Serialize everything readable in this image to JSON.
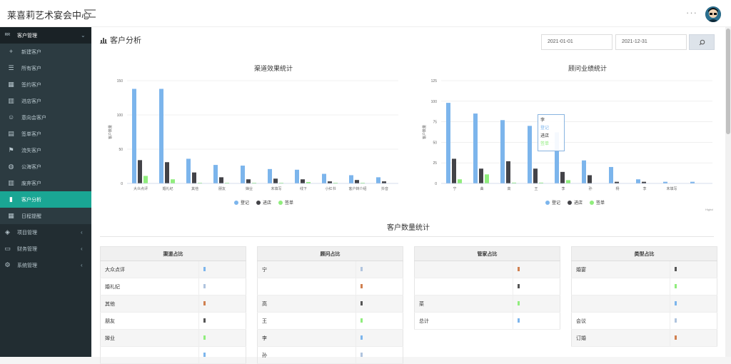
{
  "header": {
    "brand": "莱喜莉艺术宴会中心",
    "more": "···"
  },
  "sidebar": {
    "items": [
      {
        "label": "客户管理",
        "icon": "users-icon",
        "type": "parent",
        "chev": "⌄"
      },
      {
        "label": "新建客户",
        "icon": "plus-icon",
        "type": "child"
      },
      {
        "label": "所有客户",
        "icon": "list-icon",
        "type": "child"
      },
      {
        "label": "签约客户",
        "icon": "calendar-icon",
        "type": "child"
      },
      {
        "label": "进店客户",
        "icon": "bank-icon",
        "type": "child"
      },
      {
        "label": "意向会客户",
        "icon": "smile-icon",
        "type": "child"
      },
      {
        "label": "签单客户",
        "icon": "file-icon",
        "type": "child"
      },
      {
        "label": "流失客户",
        "icon": "flag-icon",
        "type": "child"
      },
      {
        "label": "公海客户",
        "icon": "globe-icon",
        "type": "child"
      },
      {
        "label": "废弃客户",
        "icon": "bank-icon",
        "type": "child"
      },
      {
        "label": "客户分析",
        "icon": "bar-chart-icon",
        "type": "active"
      },
      {
        "label": "日程提醒",
        "icon": "calendar-icon",
        "type": "child"
      },
      {
        "label": "项目管理",
        "icon": "cube-icon",
        "type": "group",
        "chev": "‹"
      },
      {
        "label": "财务管理",
        "icon": "money-icon",
        "type": "group",
        "chev": "‹"
      },
      {
        "label": "系统管理",
        "icon": "gear-icon",
        "type": "group",
        "chev": "‹"
      }
    ]
  },
  "main": {
    "page_title": "客户分析",
    "start_date": "2021-01-01",
    "end_date": "2021-12-31",
    "section_title": "客户数量统计",
    "credit": "Highcl"
  },
  "tooltip": {
    "lines": [
      "李",
      "登记",
      "进店",
      "签单"
    ]
  },
  "colors": {
    "blue": "#7cb5ec",
    "black": "#434348",
    "green": "#90ed7d",
    "teal": "#1aa694"
  },
  "chart_data": [
    {
      "type": "bar",
      "title": "渠道效果统计",
      "ylabel": "客户数量",
      "ylim": [
        0,
        150
      ],
      "yticks": [
        0,
        50,
        100,
        150
      ],
      "categories": [
        "大众点评",
        "婚礼纪",
        "其他",
        "朋友",
        "婵业",
        "未填写",
        "线下",
        "小红书",
        "客户转介绍",
        "抖音"
      ],
      "series": [
        {
          "name": "登记",
          "values": [
            138,
            138,
            36,
            27,
            26,
            21,
            20,
            14,
            12,
            9
          ]
        },
        {
          "name": "进店",
          "values": [
            34,
            31,
            16,
            9,
            6,
            7,
            6,
            3,
            5,
            3
          ]
        },
        {
          "name": "签单",
          "values": [
            11,
            6,
            1,
            1,
            1,
            1,
            2,
            1,
            1,
            0
          ]
        }
      ],
      "legend": "bottom-center"
    },
    {
      "type": "bar",
      "title": "顾问业绩统计",
      "ylabel": "客户数量",
      "ylim": [
        0,
        125
      ],
      "yticks": [
        0,
        25,
        50,
        75,
        100,
        125
      ],
      "categories": [
        "宁",
        "曲",
        "高",
        "王",
        "李",
        "孙",
        "杨",
        "李",
        "未填写",
        ""
      ],
      "series": [
        {
          "name": "登记",
          "values": [
            98,
            85,
            77,
            70,
            62,
            28,
            20,
            5,
            2,
            2
          ]
        },
        {
          "name": "进店",
          "values": [
            30,
            18,
            27,
            18,
            14,
            10,
            2,
            2,
            0,
            0
          ]
        },
        {
          "name": "签单",
          "values": [
            5,
            11,
            1,
            1,
            4,
            0,
            0,
            0,
            0,
            0
          ]
        }
      ],
      "legend": "bottom-center"
    }
  ],
  "tables": [
    {
      "header": "渠道占比",
      "rows": [
        "大众点评",
        "婚礼纪",
        "其他",
        "朋友",
        "婵业",
        ""
      ]
    },
    {
      "header": "顾问占比",
      "rows": [
        "宁",
        "",
        "高",
        "王",
        "李",
        "孙"
      ]
    },
    {
      "header": "管家占比",
      "rows": [
        "",
        "",
        "菜",
        "总计"
      ]
    },
    {
      "header": "类型占比",
      "rows": [
        "婚宴",
        "",
        "",
        "会议",
        "订婚"
      ]
    }
  ]
}
